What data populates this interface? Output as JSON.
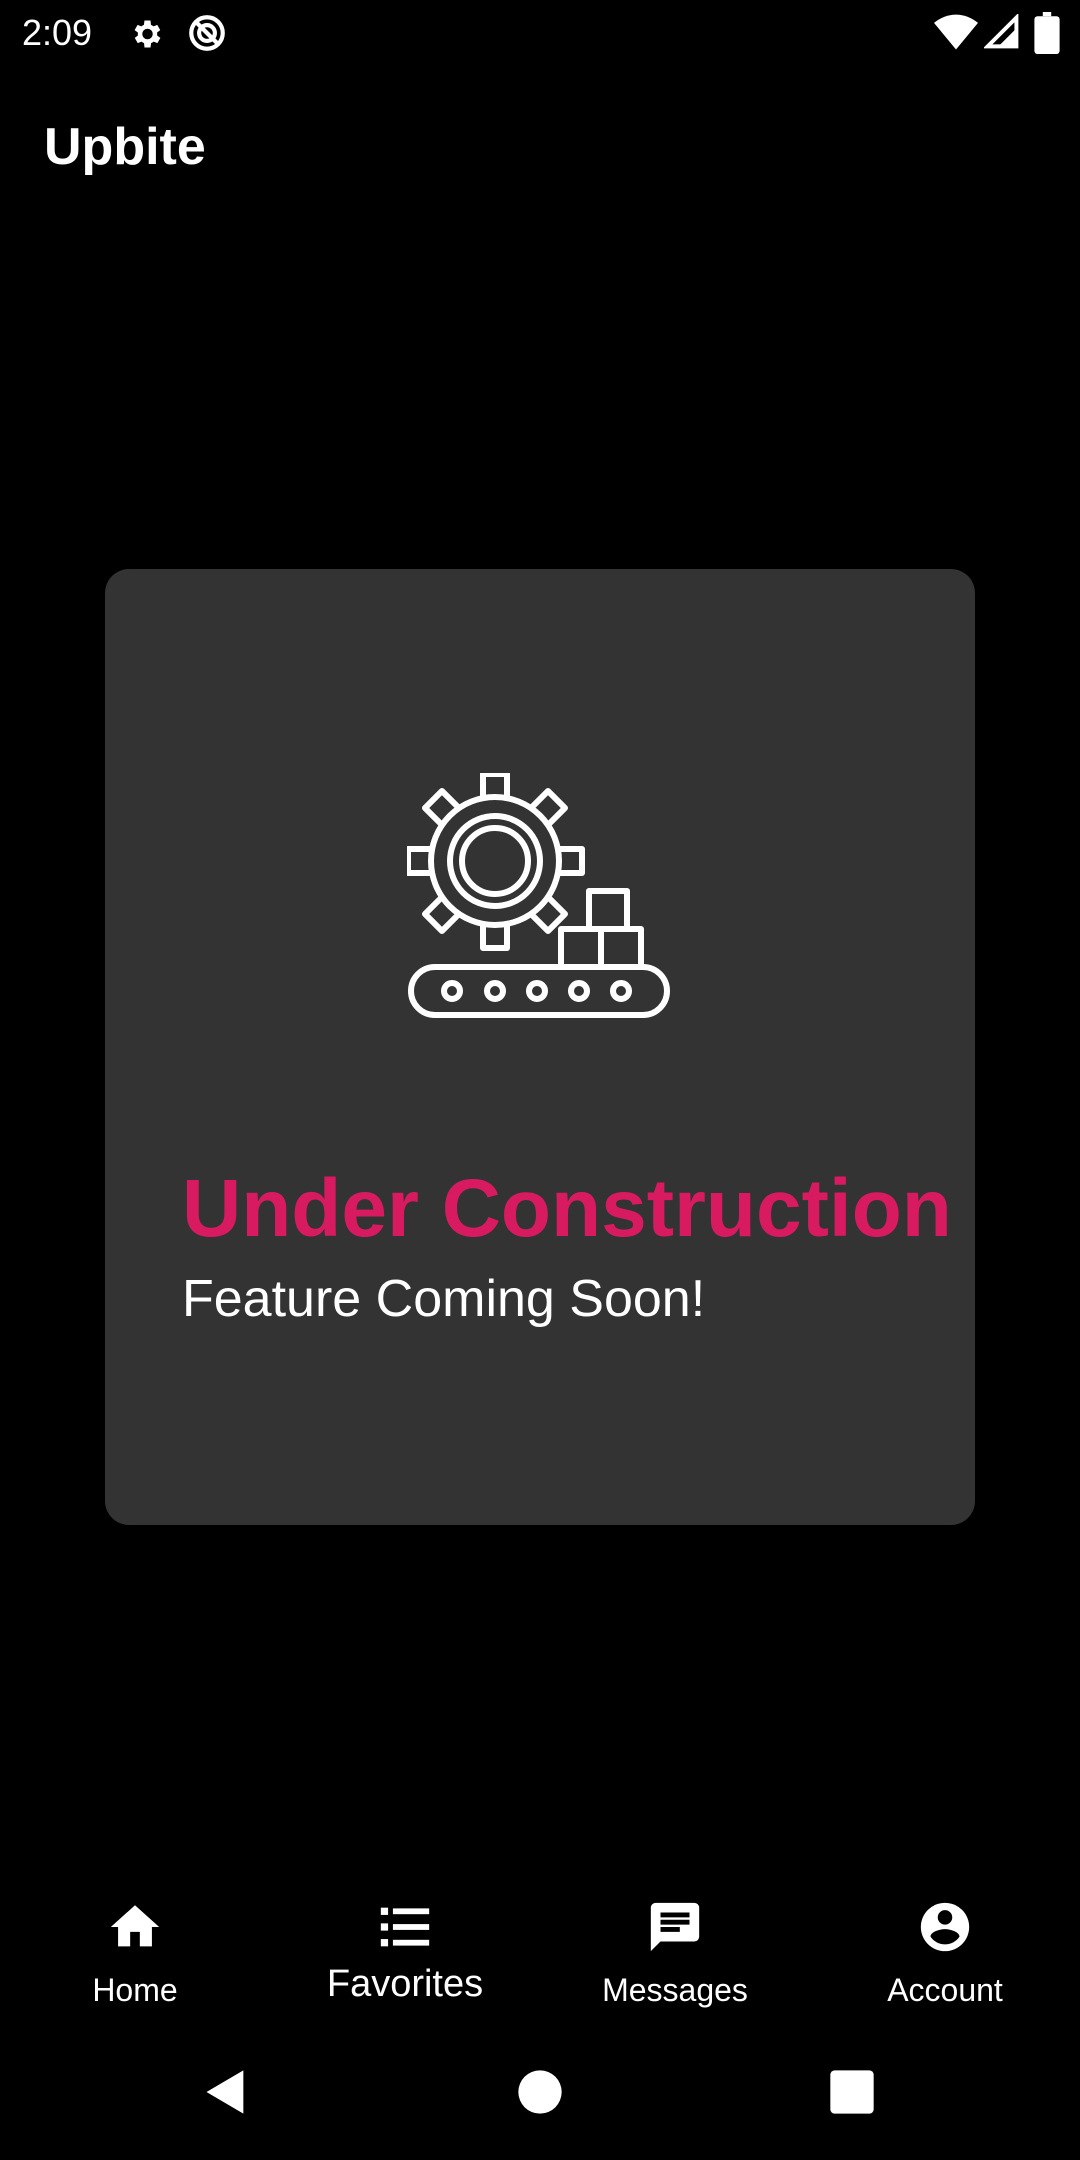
{
  "status_bar": {
    "time": "2:09",
    "left_icons": [
      "gear-icon",
      "data-saver-icon"
    ],
    "right_icons": [
      "wifi-icon",
      "cell-signal-icon",
      "battery-icon"
    ]
  },
  "app": {
    "title": "Upbite"
  },
  "placeholder": {
    "icon": "gear-conveyor-icon",
    "heading": "Under Construction",
    "subheading": "Feature Coming Soon!",
    "heading_color": "#d81b60",
    "card_color": "#333333"
  },
  "bottom_nav": {
    "items": [
      {
        "label": "Home",
        "icon": "home-icon"
      },
      {
        "label": "Favorites",
        "icon": "list-icon",
        "selected": true
      },
      {
        "label": "Messages",
        "icon": "message-icon"
      },
      {
        "label": "Account",
        "icon": "account-circle-icon"
      }
    ]
  },
  "system_nav": {
    "buttons": [
      "back-icon",
      "home-circle-icon",
      "recents-icon"
    ]
  }
}
